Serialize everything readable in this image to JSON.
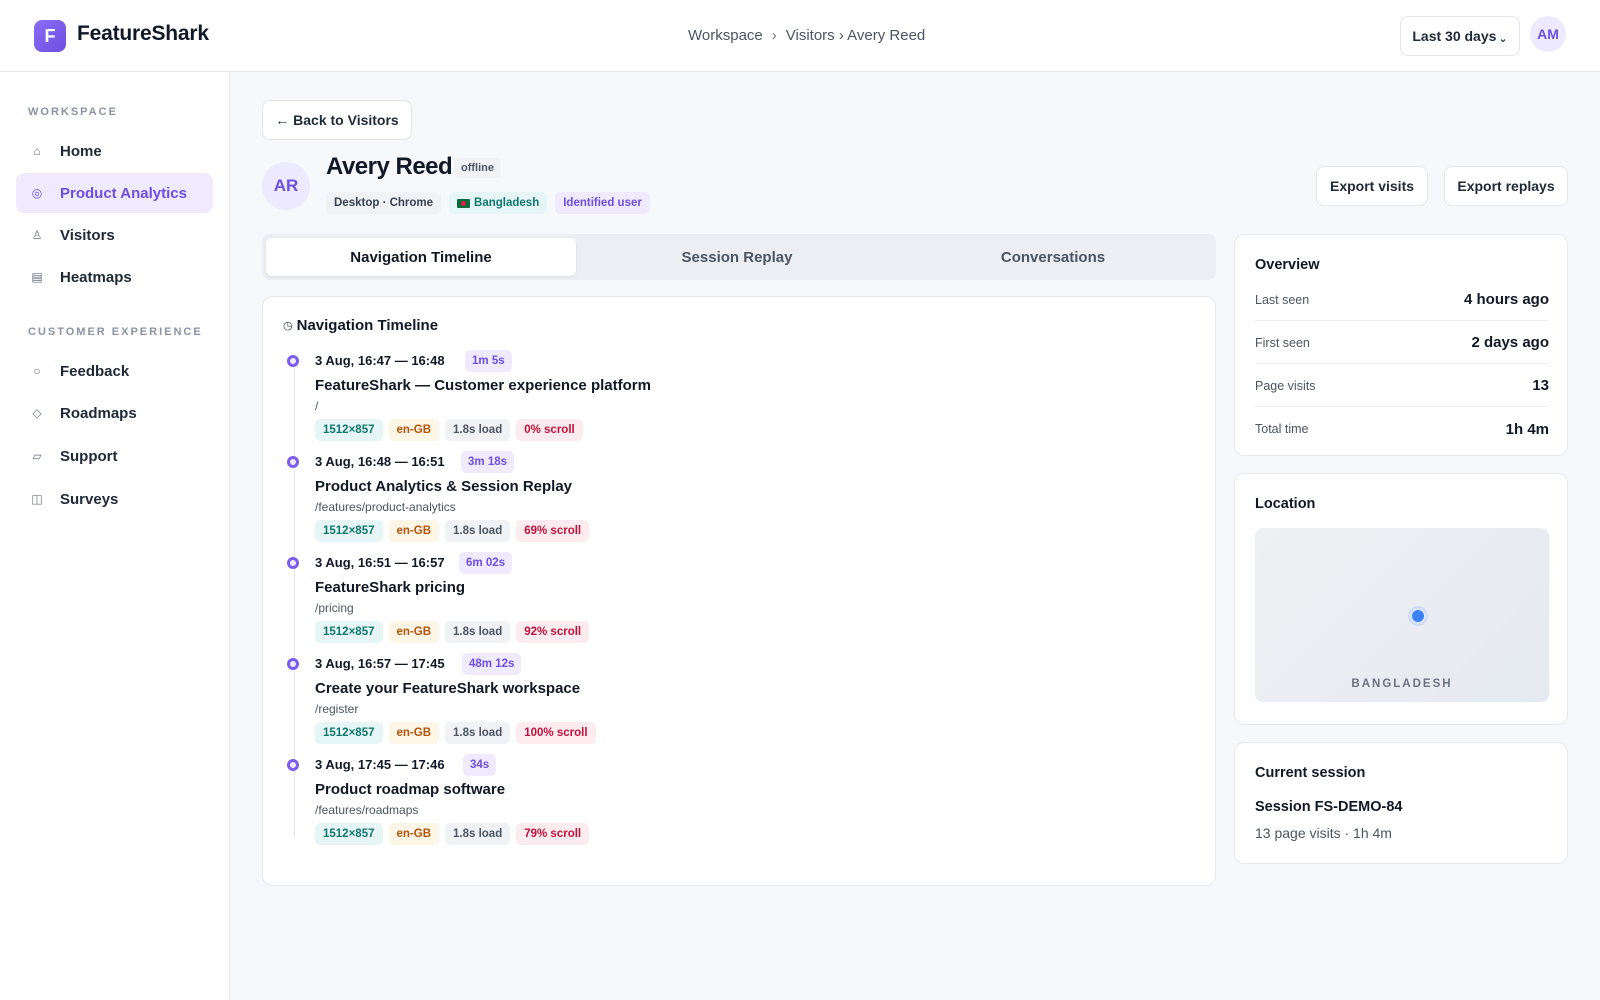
{
  "app": {
    "logo_letter": "F",
    "name": "FeatureShark"
  },
  "breadcrumb": {
    "workspace": "Workspace",
    "sep": "›",
    "path": "Visitors › Avery Reed"
  },
  "header": {
    "range_label": "Last 30 days",
    "range_chevron": "⌄",
    "avatar_initials": "AM"
  },
  "sidebar": {
    "sections": [
      {
        "heading": "WORKSPACE"
      },
      {
        "heading": "CUSTOMER EXPERIENCE"
      }
    ],
    "items": [
      {
        "icon": "⌂",
        "icon_name": "home-icon",
        "label": "Home"
      },
      {
        "icon": "◎",
        "icon_name": "analytics-icon",
        "label": "Product Analytics",
        "active": true
      },
      {
        "icon": "♙",
        "icon_name": "visitors-icon",
        "label": "Visitors"
      },
      {
        "icon": "▤",
        "icon_name": "heatmap-icon",
        "label": "Heatmaps"
      },
      {
        "icon": "○",
        "icon_name": "feedback-icon",
        "label": "Feedback"
      },
      {
        "icon": "◇",
        "icon_name": "roadmap-icon",
        "label": "Roadmaps"
      },
      {
        "icon": "▱",
        "icon_name": "support-icon",
        "label": "Support"
      },
      {
        "icon": "◫",
        "icon_name": "survey-icon",
        "label": "Surveys"
      }
    ]
  },
  "back_label": "← Back to Visitors",
  "visitor": {
    "initials": "AR",
    "name": "Avery Reed",
    "status": "offline",
    "device": "Desktop · Chrome",
    "country": "Bangladesh",
    "identity": "Identified user"
  },
  "actions": {
    "export_visits": "Export visits",
    "export_replays": "Export replays"
  },
  "tabs": [
    {
      "label": "Navigation Timeline",
      "active": true
    },
    {
      "label": "Session Replay"
    },
    {
      "label": "Conversations"
    }
  ],
  "timeline": {
    "title": "Navigation Timeline",
    "clock_icon": "◷",
    "entries": [
      {
        "time": "3 Aug, 16:47 — 16:48",
        "duration": "1m 5s",
        "page": "FeatureShark — Customer experience platform",
        "path": "/",
        "resolution": "1512×857",
        "locale": "en-GB",
        "load": "1.8s load",
        "scroll": "0% scroll"
      },
      {
        "time": "3 Aug, 16:48 — 16:51",
        "duration": "3m 18s",
        "page": "Product Analytics & Session Replay",
        "path": "/features/product-analytics",
        "resolution": "1512×857",
        "locale": "en-GB",
        "load": "1.8s load",
        "scroll": "69% scroll"
      },
      {
        "time": "3 Aug, 16:51 — 16:57",
        "duration": "6m 02s",
        "page": "FeatureShark pricing",
        "path": "/pricing",
        "resolution": "1512×857",
        "locale": "en-GB",
        "load": "1.8s load",
        "scroll": "92% scroll"
      },
      {
        "time": "3 Aug, 16:57 — 17:45",
        "duration": "48m 12s",
        "page": "Create your FeatureShark workspace",
        "path": "/register",
        "resolution": "1512×857",
        "locale": "en-GB",
        "load": "1.8s load",
        "scroll": "100% scroll"
      },
      {
        "time": "3 Aug, 17:45 — 17:46",
        "duration": "34s",
        "page": "Product roadmap software",
        "path": "/features/roadmaps",
        "resolution": "1512×857",
        "locale": "en-GB",
        "load": "1.8s load",
        "scroll": "79% scroll"
      }
    ]
  },
  "overview": {
    "title": "Overview",
    "rows": [
      {
        "label": "Last seen",
        "value": "4 hours ago"
      },
      {
        "label": "First seen",
        "value": "2 days ago"
      },
      {
        "label": "Page visits",
        "value": "13"
      },
      {
        "label": "Total time",
        "value": "1h 4m"
      }
    ]
  },
  "location": {
    "title": "Location",
    "country_label": "BANGLADESH"
  },
  "current_session": {
    "title": "Current session",
    "name": "Session FS-DEMO-84",
    "meta": "13 page visits · 1h 4m"
  }
}
